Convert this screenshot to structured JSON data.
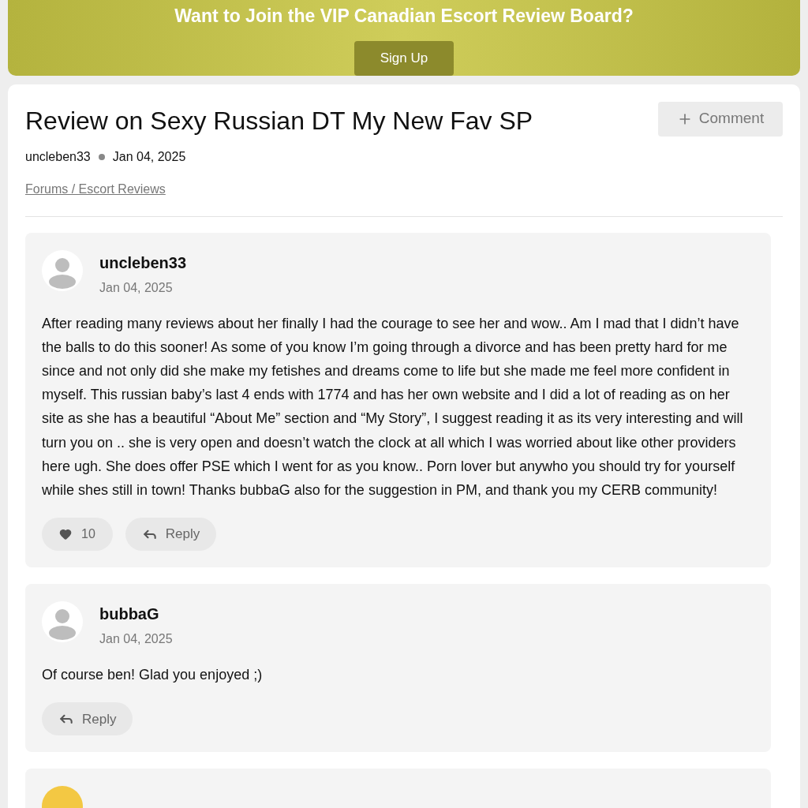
{
  "banner": {
    "title": "Want to Join the VIP Canadian Escort Review Board?",
    "button": "Sign Up"
  },
  "thread": {
    "title": "Review on Sexy Russian DT My New Fav SP",
    "author": "uncleben33",
    "date": "Jan 04, 2025",
    "breadcrumb": "Forums / Escort Reviews",
    "comment_button": "Comment"
  },
  "posts": [
    {
      "author": "uncleben33",
      "date": "Jan 04, 2025",
      "body": "After reading many reviews about her finally I had the courage to see her and wow.. Am I mad that I didn’t have the balls to do this sooner! As some of you know I’m going through a divorce and has been pretty hard for me since and not only did she make my fetishes and dreams come to life but she made me feel more confident in myself. This russian baby’s last 4 ends with 1774 and has her own website and I did a lot of reading as on her site as she has a beautiful “About Me” section and “My Story”, I suggest reading it as its very interesting and will turn you on .. she is very open and doesn’t watch the clock at all which I was worried about like other providers here ugh. She does offer PSE which I went for as you know.. Porn lover but anywho you should try for yourself while shes still in town! Thanks bubbaG also for the suggestion in PM, and thank you my CERB community!",
      "likes": "10",
      "reply": "Reply"
    },
    {
      "author": "bubbaG",
      "date": "Jan 04, 2025",
      "body": "Of course ben! Glad you enjoyed ;)",
      "reply": "Reply"
    }
  ]
}
